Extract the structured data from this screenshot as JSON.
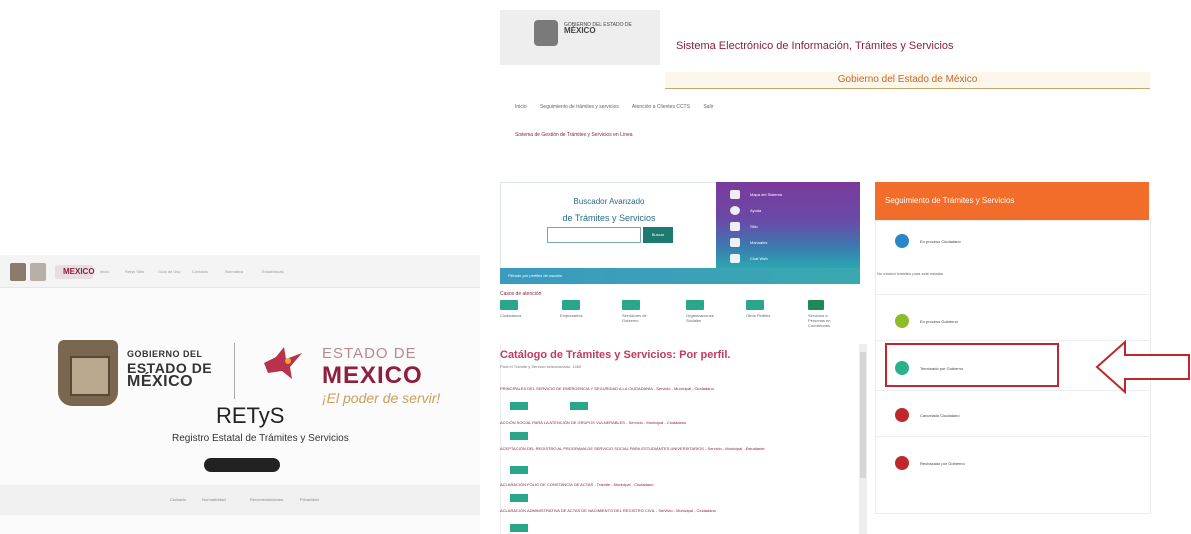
{
  "left": {
    "nav_items": [
      "Inicio",
      "Retys Sitio",
      "Guía de Uso",
      "Contacto",
      "Normativa",
      "Estadísticas"
    ],
    "gob_line1": "GOBIERNO DEL",
    "gob_line2": "ESTADO DE",
    "gob_line3": "MÉXICO",
    "edomex_line1": "ESTADO DE",
    "edomex_line2": "MEXICO",
    "edomex_slogan": "¡El poder de servir!",
    "retys": "RETyS",
    "retys_subtitle": "Registro Estatal de Trámites y Servicios",
    "footer_items": [
      "Contacto",
      "Normatividad",
      "Recomendaciones",
      "Privacidad"
    ]
  },
  "right": {
    "logo_small": "GOBIERNO DEL ESTADO DE",
    "logo_big": "MÉXICO",
    "site_title": "Sistema Electrónico de Información, Trámites y Servicios",
    "gov_bar": "Gobierno del Estado de México",
    "nav_items": [
      "Inicio",
      "Seguimiento de trámites y servicios",
      "Atención a Clientes CCTS",
      "Salir"
    ],
    "subnav": "Sistema de Gestión de Trámites y Servicios en Línea",
    "search_title1": "Buscador Avanzado",
    "search_title2": "de Trámites y Servicios",
    "search_button": "Buscar",
    "purple_items": [
      "Mapa del Sistema",
      "Ayuda",
      "Sitio",
      "Manuales",
      "Chat Web"
    ],
    "teal_bar": "Filtrado por perfiles de usuario",
    "cat_label": "Casos de atención",
    "categories": [
      "Ciudadanos",
      "Empresarios",
      "Servidores de Gobierno",
      "Organizaciones Sociales",
      "Otros Perfiles",
      "Servicios a Personas en Condiciones"
    ],
    "catalog_title": "Catálogo de Trámites y Servicios: Por perfil.",
    "catalog_sub": "Para el Trámite y Servicio seleccionado: 1469",
    "catalog_rows": [
      "PRINCIPALES DEL SERVICIO DE EMERGENCIA Y SEGURIDAD A LA CIUDADANÍA - Servicio - Municipal - Ciudadano",
      "ACCIÓN SOCIAL PARA LA ATENCIÓN DE GRUPOS VULNERABLES - Servicio - Municipal - Ciudadano",
      "ACEPTACIÓN DEL REGISTRO AL PROGRAMA DE SERVICIO SOCIAL PARA ESTUDIANTES UNIVERSITARIOS - Servicio - Municipal - Estudiante",
      "ACLARACIÓN FOLIO DE CONSTANCIA DE ACTAS - Trámite - Municipal - Ciudadano",
      "ACLARACIÓN ADMINISTRATIVA DE ACTAS DE NACIMIENTO DEL REGISTRO CIVIL - Servicio - Municipal - Ciudadano"
    ],
    "side_title": "Seguimiento de Trámites y Servicios",
    "status_items": [
      "En proceso Ciudadano",
      "En proceso Gobierno",
      "Terminado por Gobierno",
      "Cancelado Ciudadano",
      "Rechazado por Gobierno"
    ],
    "no_results": "No existen trámites para este estatus",
    "colors": {
      "accent": "#8e1f3e",
      "orange": "#f26c2a",
      "teal": "#2aa78a",
      "highlight": "#c0272d"
    }
  }
}
